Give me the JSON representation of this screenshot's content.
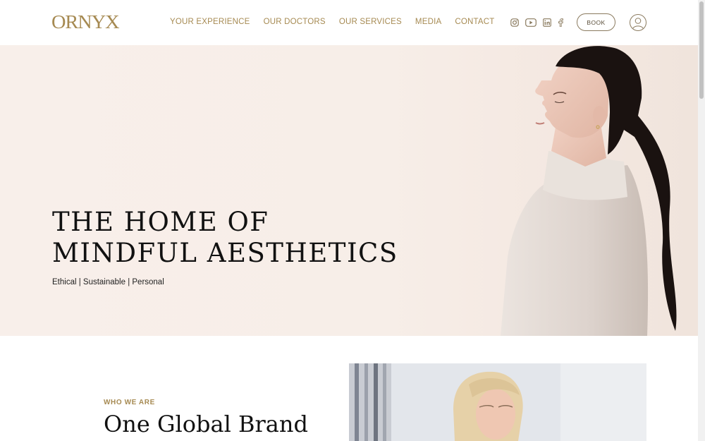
{
  "brand": {
    "logo": "ORNYX",
    "accent": "#a68a52"
  },
  "nav": [
    {
      "label": "YOUR EXPERIENCE"
    },
    {
      "label": "OUR DOCTORS"
    },
    {
      "label": "OUR SERVICES"
    },
    {
      "label": "MEDIA"
    },
    {
      "label": "CONTACT"
    }
  ],
  "header": {
    "social_icons": [
      "instagram-icon",
      "youtube-icon",
      "linkedin-icon",
      "facebook-icon"
    ],
    "book_label": "BOOK",
    "account_icon": "user-icon"
  },
  "hero": {
    "title_line1": "THE HOME OF",
    "title_line2": "MINDFUL AESTHETICS",
    "subtitle": "Ethical | Sustainable | Personal"
  },
  "about": {
    "eyebrow": "WHO WE ARE",
    "title": "One Global Brand"
  }
}
